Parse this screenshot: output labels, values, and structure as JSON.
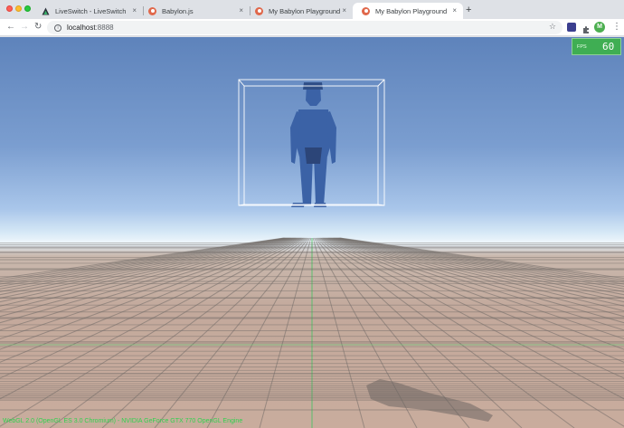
{
  "window": {
    "tabs": [
      {
        "label": "LiveSwitch - LiveSwitch",
        "favicon": "liveswitch-icon"
      },
      {
        "label": "Babylon.js",
        "favicon": "babylon-icon"
      },
      {
        "label": "My Babylon Playground",
        "favicon": "babylon-icon"
      },
      {
        "label": "My Babylon Playground",
        "favicon": "babylon-icon",
        "active": true
      }
    ],
    "close_glyph": "×",
    "new_tab_glyph": "+"
  },
  "toolbar": {
    "url_host": "localhost",
    "url_port": ":8888",
    "avatar_letter": "M"
  },
  "scene": {
    "fps_label": "FPS",
    "fps_value": "60",
    "engine_info": "WebGL 2.0 (OpenGL ES 3.0 Chromium) - NVIDIA GeForce GTX 770 OpenGL Engine",
    "colors": {
      "sky_top": "#5e83bb",
      "horizon": "#eef6fb",
      "ground": "#c6ab9d",
      "grid_line": "#706a66",
      "axis_line": "#56c06a",
      "character": "#3b62a6",
      "bounding_box": "#ffffff",
      "fps_panel": "#3fae53",
      "info_text": "#2fd24e"
    }
  }
}
